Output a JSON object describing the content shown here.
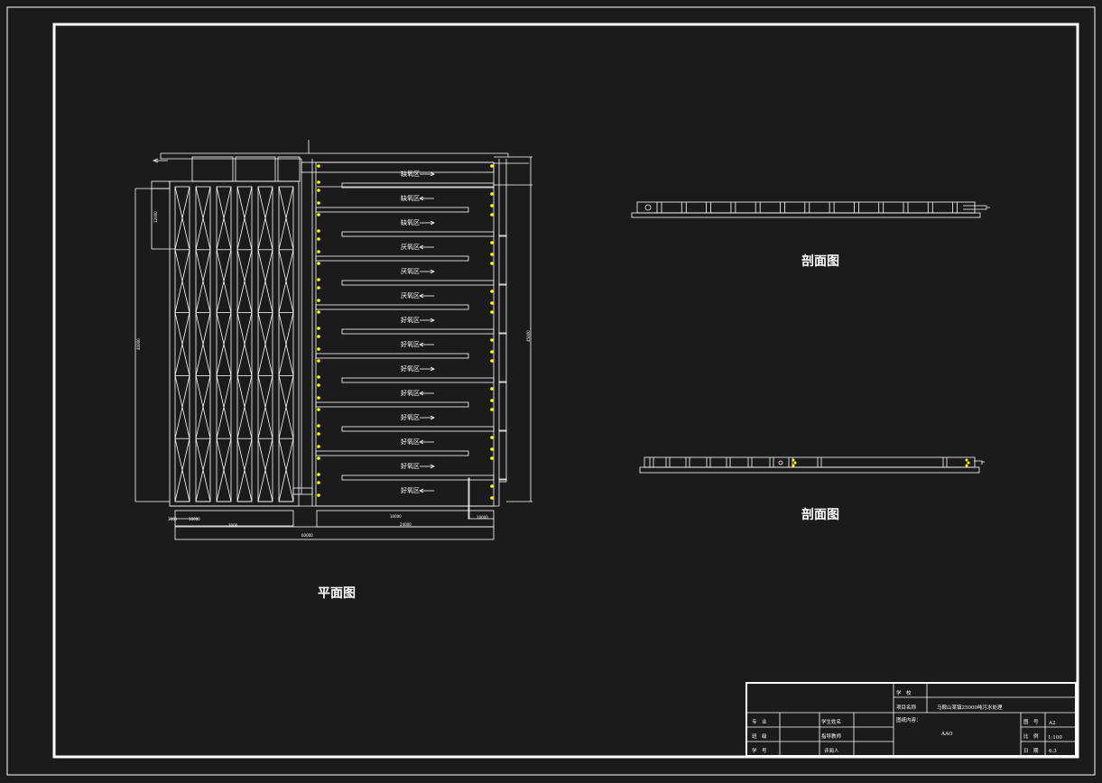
{
  "colors": {
    "background": "#1b1b1b",
    "line": "#ffffff",
    "accent": "#ffff00"
  },
  "captions": {
    "plan": "平面图",
    "section_top": "剖面图",
    "section_bottom": "剖面图"
  },
  "zone_labels": [
    {
      "text": "缺氧区",
      "dir": "right"
    },
    {
      "text": "缺氧区",
      "dir": "left"
    },
    {
      "text": "缺氧区",
      "dir": "right"
    },
    {
      "text": "厌氧区",
      "dir": "left"
    },
    {
      "text": "厌氧区",
      "dir": "right"
    },
    {
      "text": "厌氧区",
      "dir": "left"
    },
    {
      "text": "好氧区",
      "dir": "right"
    },
    {
      "text": "好氧区",
      "dir": "left"
    },
    {
      "text": "好氧区",
      "dir": "right"
    },
    {
      "text": "好氧区",
      "dir": "left"
    },
    {
      "text": "好氧区",
      "dir": "right"
    },
    {
      "text": "好氧区",
      "dir": "left"
    },
    {
      "text": "好氧区",
      "dir": "right"
    },
    {
      "text": "好氧区",
      "dir": "left"
    }
  ],
  "dimensions": {
    "bottom_left": "3000",
    "bottom_small": "10000",
    "bottom_mid": "2000",
    "bottom_right": "24000",
    "bottom_right_small": "10000",
    "bottom_total": "60000",
    "left_overall": "40000",
    "left_top": "12000",
    "right_side": "45000"
  },
  "title_block": {
    "school_label": "学　校",
    "school_value": "",
    "project_label": "项目名称",
    "project_value": "马鞍山某镇25000吨污水处理",
    "major_label": "专　业",
    "student_label": "学生姓名",
    "class_label": "班　级",
    "advisor_label": "指导教师",
    "id_label": "学　号",
    "reviewer_label": "评阅人",
    "content_label": "图纸内容：",
    "content_value": "AAO",
    "drawing_no_label": "图　号",
    "drawing_no_value": "A2",
    "scale_label": "比　例",
    "scale_value": "1:100",
    "date_label": "日　期",
    "date_value": "6.3"
  }
}
